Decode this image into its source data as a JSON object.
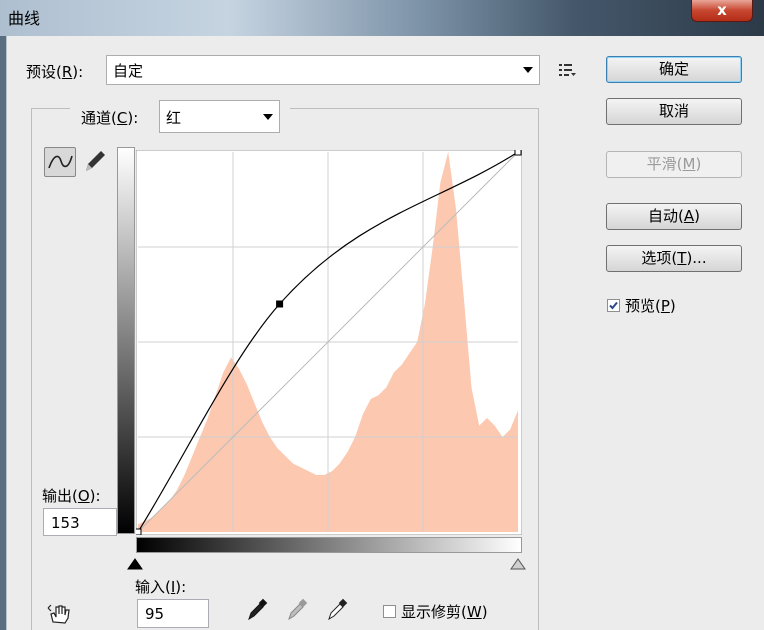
{
  "window": {
    "title": "曲线",
    "close_label": "x"
  },
  "preset": {
    "label_prefix": "预设(",
    "label_key": "R",
    "label_suffix": "):",
    "value": "自定"
  },
  "channel": {
    "label_prefix": "通道(",
    "label_key": "C",
    "label_suffix": "):",
    "value": "红"
  },
  "buttons": {
    "ok": "确定",
    "cancel": "取消",
    "smooth_prefix": "平滑(",
    "smooth_key": "M",
    "smooth_suffix": ")",
    "auto_prefix": "自动(",
    "auto_key": "A",
    "auto_suffix": ")",
    "options_prefix": "选项(",
    "options_key": "T",
    "options_suffix": ")..."
  },
  "preview": {
    "label_prefix": "预览(",
    "label_key": "P",
    "label_suffix": ")",
    "checked": true
  },
  "output": {
    "label_prefix": "输出(",
    "label_key": "O",
    "label_suffix": "):",
    "value": "153"
  },
  "input": {
    "label_prefix": "输入(",
    "label_key": "I",
    "label_suffix": "):",
    "value": "95"
  },
  "clipping": {
    "label_prefix": "显示修剪(",
    "label_key": "W",
    "label_suffix": ")",
    "checked": false
  },
  "colors": {
    "histogram": "#fcc8b0",
    "curve": "#000000",
    "default_button_border": "#3c7fb1"
  },
  "icons": [
    "curve-mode-icon",
    "pencil-icon",
    "preset-menu-icon",
    "hand-adjust-icon",
    "black-eyedropper-icon",
    "gray-eyedropper-icon",
    "white-eyedropper-icon"
  ],
  "chart_data": {
    "type": "area",
    "xlim": [
      0,
      255
    ],
    "ylim": [
      0,
      255
    ],
    "grid": true,
    "curve_points": [
      {
        "x": 0,
        "y": 0
      },
      {
        "x": 95,
        "y": 153
      },
      {
        "x": 255,
        "y": 255
      }
    ],
    "histogram_heights": [
      0.02,
      0.03,
      0.04,
      0.06,
      0.08,
      0.11,
      0.15,
      0.2,
      0.25,
      0.3,
      0.36,
      0.42,
      0.46,
      0.43,
      0.39,
      0.34,
      0.29,
      0.25,
      0.22,
      0.2,
      0.18,
      0.17,
      0.16,
      0.15,
      0.15,
      0.16,
      0.18,
      0.21,
      0.25,
      0.31,
      0.35,
      0.36,
      0.38,
      0.42,
      0.44,
      0.47,
      0.5,
      0.6,
      0.75,
      0.92,
      1.0,
      0.85,
      0.62,
      0.38,
      0.28,
      0.3,
      0.28,
      0.25,
      0.27,
      0.32
    ]
  }
}
